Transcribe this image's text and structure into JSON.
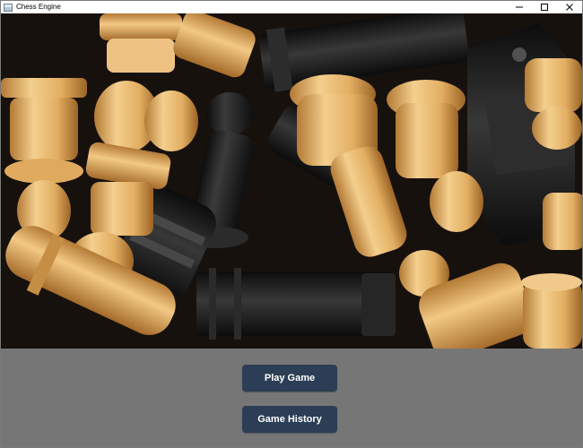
{
  "window": {
    "title": "Chess Engine",
    "icon": "app-window-icon",
    "controls": [
      "minimize-icon",
      "maximize-icon",
      "close-icon"
    ]
  },
  "hero": {
    "image": "chess-pieces-photo",
    "subject": "pile of wooden and black chess pieces"
  },
  "menu": {
    "play_label": "Play Game",
    "history_label": "Game History"
  },
  "colors": {
    "panel_background": "#767676",
    "button_background": "#2c3e55",
    "button_text": "#ffffff",
    "wood_light": "#e6b877",
    "wood_dark": "#1f1f1f"
  }
}
